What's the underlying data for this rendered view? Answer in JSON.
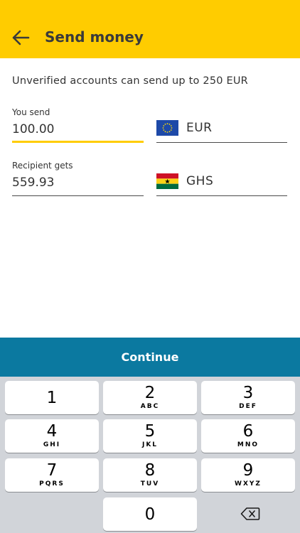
{
  "header": {
    "title": "Send money",
    "back_icon": "arrow-left-icon",
    "background": "#ffcc00"
  },
  "notice": "Unverified accounts can send up to 250 EUR",
  "send": {
    "label": "You send",
    "value": "100.00",
    "currency_code": "EUR",
    "flag_icon": "eu-flag-icon"
  },
  "receive": {
    "label": "Recipient gets",
    "value": "559.93",
    "currency_code": "GHS",
    "flag_icon": "ghana-flag-icon"
  },
  "continue_label": "Continue",
  "colors": {
    "accent": "#ffcc00",
    "primary_button": "#0b79a0"
  },
  "keypad": {
    "keys": [
      {
        "digit": "1",
        "letters": ""
      },
      {
        "digit": "2",
        "letters": "ABC"
      },
      {
        "digit": "3",
        "letters": "DEF"
      },
      {
        "digit": "4",
        "letters": "GHI"
      },
      {
        "digit": "5",
        "letters": "JKL"
      },
      {
        "digit": "6",
        "letters": "MNO"
      },
      {
        "digit": "7",
        "letters": "PQRS"
      },
      {
        "digit": "8",
        "letters": "TUV"
      },
      {
        "digit": "9",
        "letters": "WXYZ"
      },
      {
        "digit": "0",
        "letters": ""
      }
    ],
    "backspace_icon": "backspace-icon"
  }
}
